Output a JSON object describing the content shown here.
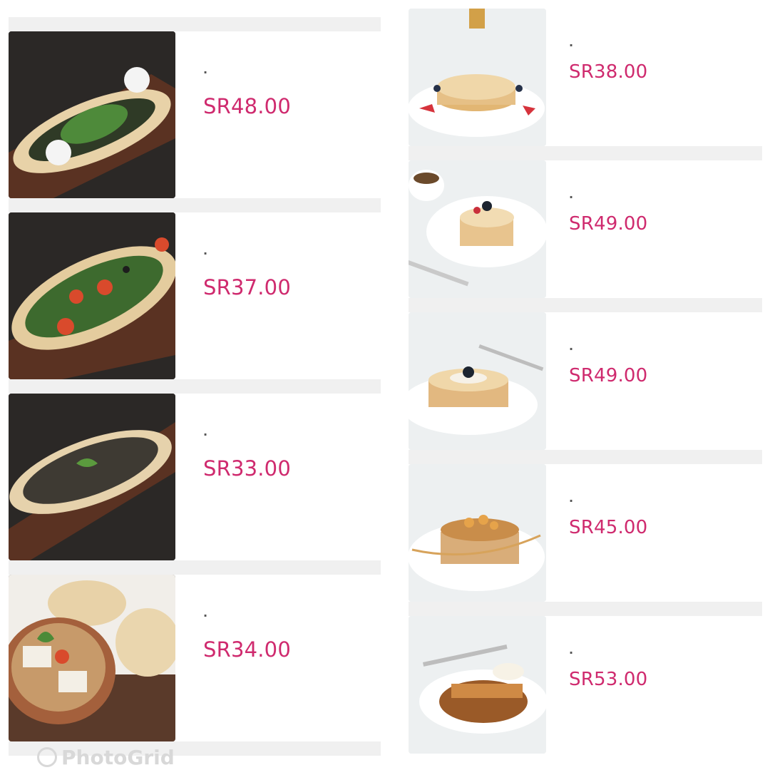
{
  "left_items": [
    {
      "name": ".",
      "price": "SR48.00",
      "image": "pide-spinach-cheese"
    },
    {
      "name": ".",
      "price": "SR37.00",
      "image": "pide-vegetable"
    },
    {
      "name": ".",
      "price": "SR33.00",
      "image": "pide-zaatar"
    },
    {
      "name": ".",
      "price": "SR34.00",
      "image": "halloumi-clay-pot-with-bread"
    }
  ],
  "right_items": [
    {
      "name": ".",
      "price": "SR38.00",
      "image": "pancakes-syrup"
    },
    {
      "name": ".",
      "price": "SR49.00",
      "image": "pancakes-berries"
    },
    {
      "name": ".",
      "price": "SR49.00",
      "image": "pancakes-cream-blueberry"
    },
    {
      "name": ".",
      "price": "SR45.00",
      "image": "pancakes-nuts-caramel"
    },
    {
      "name": ".",
      "price": "SR53.00",
      "image": "french-toast-caramel"
    }
  ],
  "watermark": "PhotoGrid",
  "colors": {
    "price": "#cf2a6e",
    "divider": "#f0f0f0"
  }
}
